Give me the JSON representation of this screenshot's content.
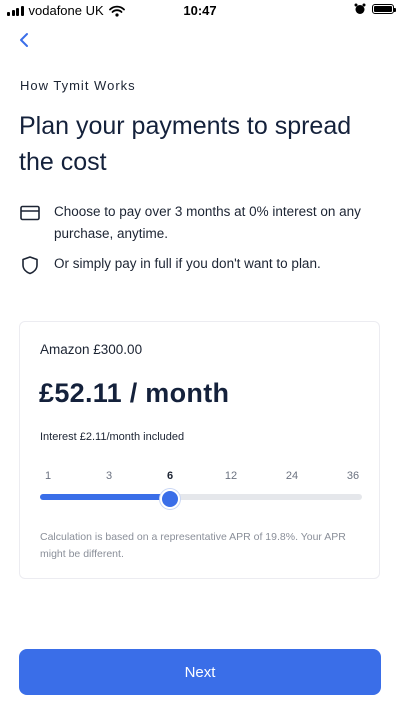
{
  "status_bar": {
    "carrier": "vodafone UK",
    "time": "10:47",
    "icons": [
      "signal-icon",
      "wifi-icon",
      "alarm-icon",
      "battery-icon"
    ]
  },
  "header": {
    "eyebrow": "How Tymit Works",
    "title": "Plan your payments to spread the cost"
  },
  "features": [
    {
      "icon": "card-icon",
      "text": "Choose to pay over 3 months at 0% interest on any purchase, anytime."
    },
    {
      "icon": "shield-icon",
      "text": "Or simply pay in full if you don't want to plan."
    }
  ],
  "card": {
    "merchant": "Amazon £300.00",
    "monthly": "£52.11 / month",
    "interest": "Interest £2.11/month included",
    "ticks": [
      "1",
      "3",
      "6",
      "12",
      "24",
      "36"
    ],
    "selected_index": 2,
    "disclaimer": "Calculation is based on a representative APR of 19.8%. Your APR might be different."
  },
  "buttons": {
    "next": "Next"
  },
  "colors": {
    "accent": "#3a6ee8",
    "title": "#14213b"
  }
}
